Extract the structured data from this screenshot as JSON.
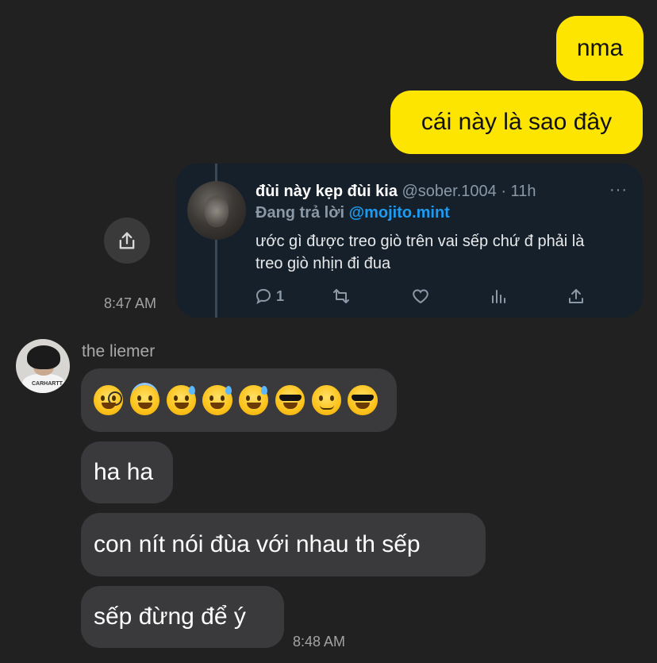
{
  "outgoing": {
    "message1": "nma",
    "message2": "cái này là sao đây",
    "time": "8:47 AM"
  },
  "tweet": {
    "name": "đùi này kẹp đùi kia",
    "handle": "@sober.1004",
    "age": "· 11h",
    "more": "···",
    "reply_label": "Đang trả lời",
    "reply_to": "@mojito.mint",
    "text": "ước gì được treo giò trên vai sếp chứ đ phải là treo giò nhịn đi đua",
    "reply_count": "1",
    "actions": [
      "reply-icon",
      "retweet-icon",
      "like-icon",
      "stats-icon",
      "share-icon"
    ]
  },
  "share_button_icon": "share-icon",
  "incoming": {
    "sender": "the liemer",
    "emojis": [
      "face-with-monocle",
      "smiling-face-with-halo",
      "grinning-face-with-sweat",
      "grinning-face-with-sweat",
      "grinning-face-with-sweat",
      "smiling-face-with-sunglasses",
      "slightly-smiling-face",
      "smiling-face-with-sunglasses"
    ],
    "message2": "ha ha",
    "message3": "con nít nói đùa với nhau th sếp",
    "message4": "sếp đừng để ý",
    "time": "8:48 AM"
  },
  "colors": {
    "background": "#212121",
    "outgoing_bubble": "#fee500",
    "incoming_bubble": "#3a3a3c",
    "tweet_background": "#15202b",
    "link_blue": "#1d9bf0"
  }
}
